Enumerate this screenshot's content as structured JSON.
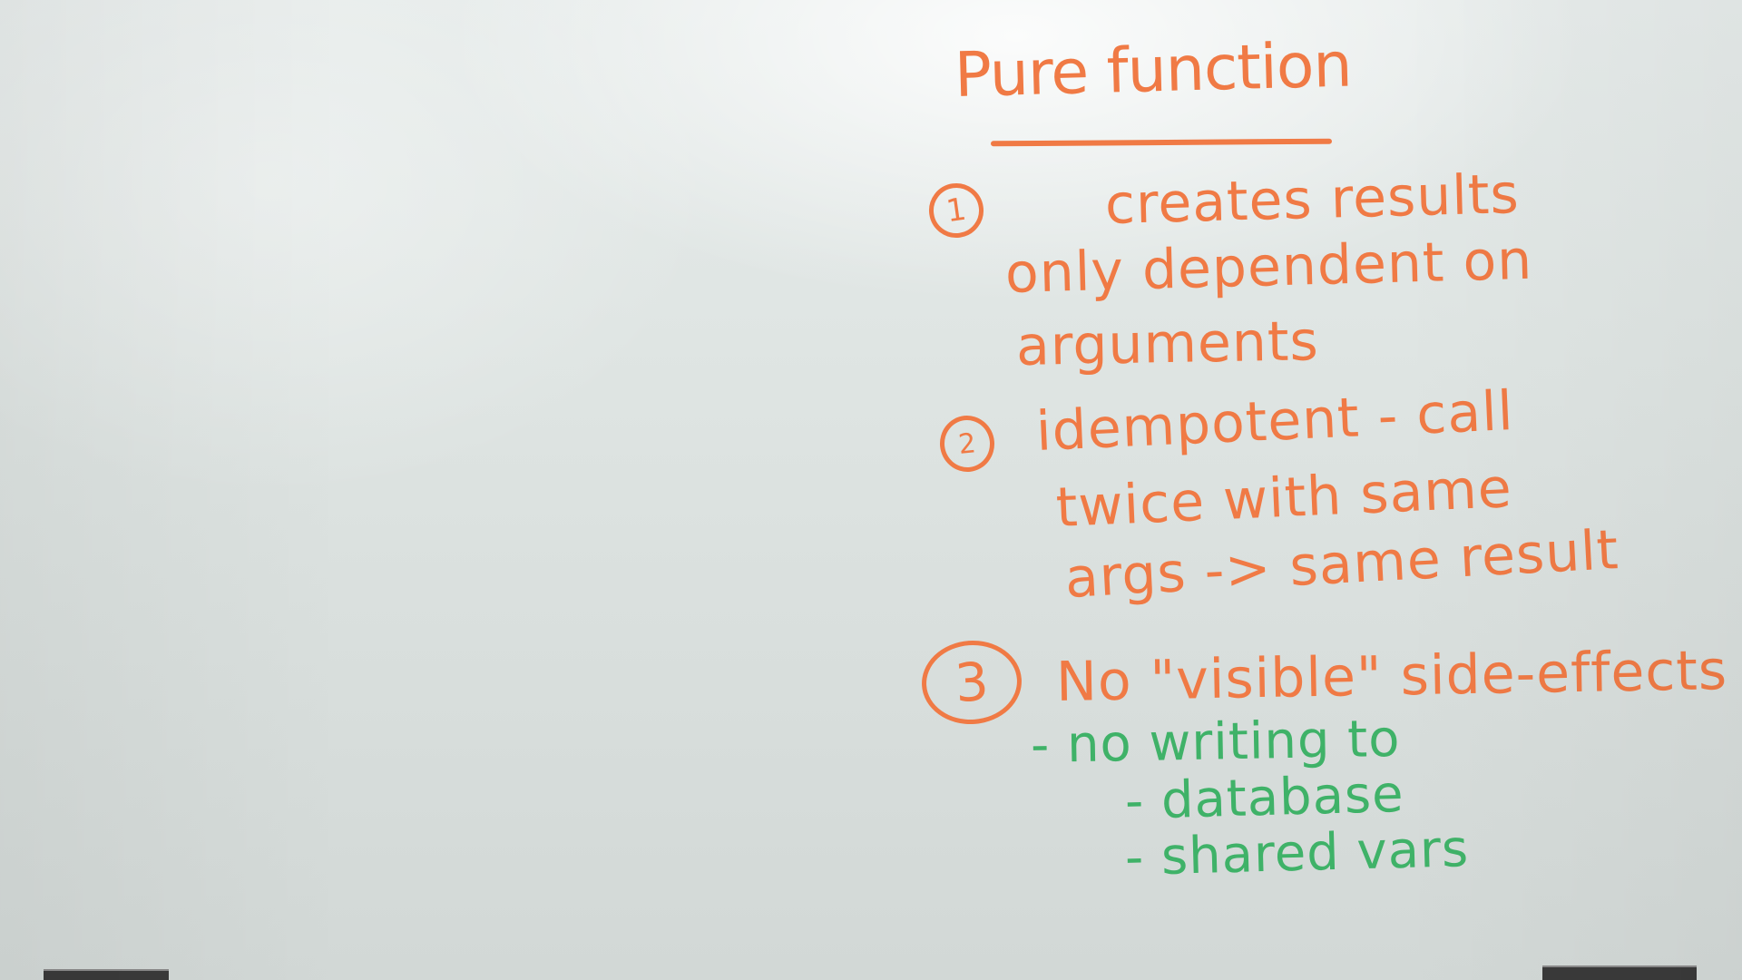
{
  "board": {
    "title": "Pure function",
    "items": [
      {
        "number": "1",
        "lines": [
          "creates results",
          "only dependent on",
          "arguments"
        ]
      },
      {
        "number": "2",
        "lines": [
          "idempotent - call",
          "twice with same",
          "args -> same result"
        ]
      },
      {
        "number": "3",
        "lines": [
          "No \"visible\" side-effects"
        ],
        "sub_lines": [
          "- no writing to",
          "- database",
          "- shared vars"
        ]
      }
    ]
  },
  "colors": {
    "ink_primary": "#f07a45",
    "ink_secondary": "#3fb268",
    "board_surface": "#dfe5e3"
  }
}
